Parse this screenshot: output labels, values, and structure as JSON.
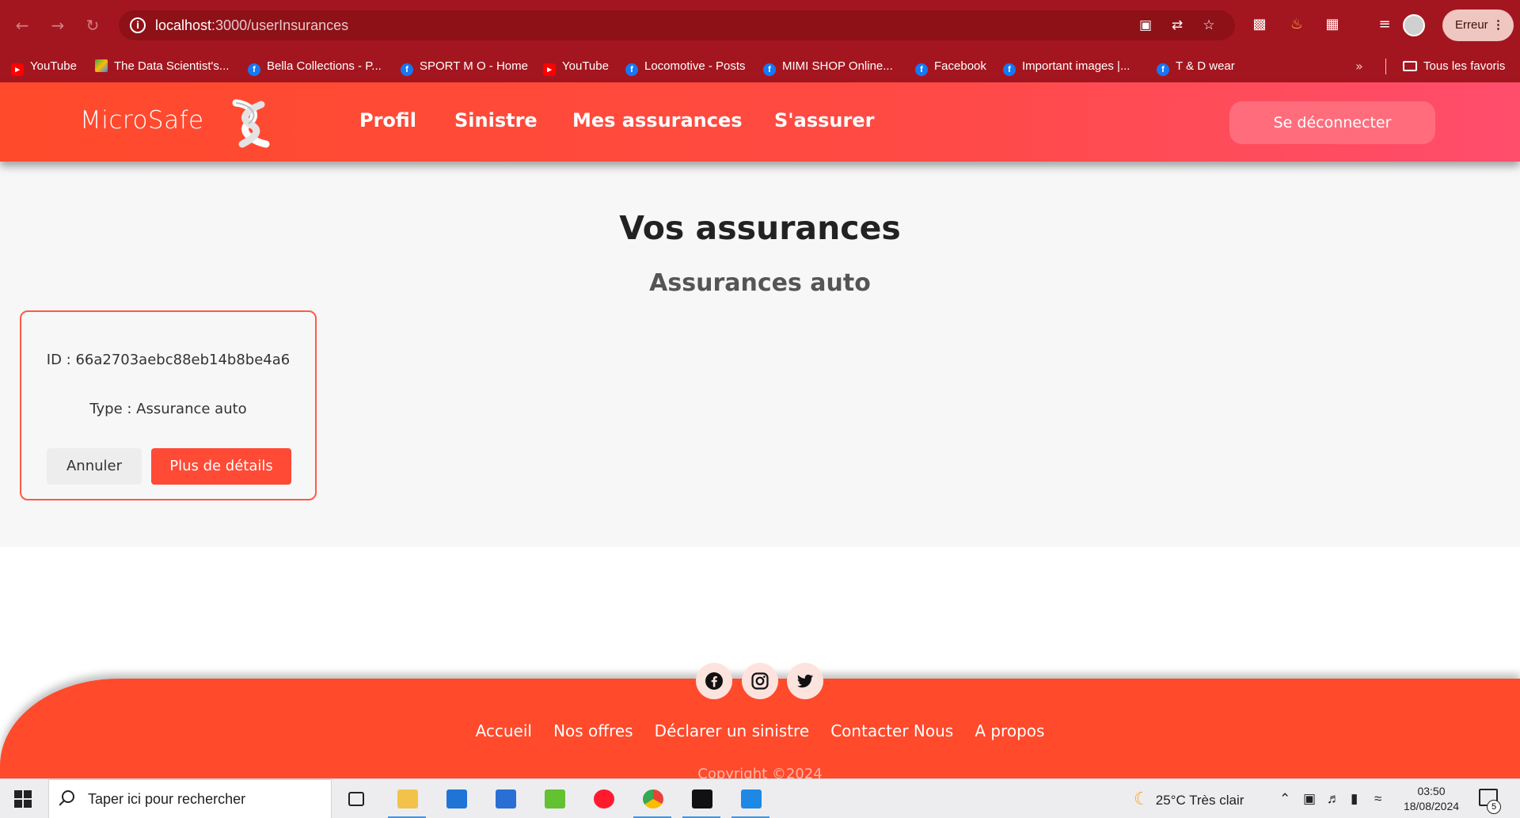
{
  "browser": {
    "url_host": "localhost",
    "url_path": ":3000/userInsurances",
    "profile_label": "Erreur",
    "bookmarks": [
      {
        "label": "YouTube",
        "icon": "youtube-icon"
      },
      {
        "label": "The Data Scientist's...",
        "icon": "google-drive-icon"
      },
      {
        "label": "Bella Collections - P...",
        "icon": "facebook-icon"
      },
      {
        "label": "SPORT M O - Home",
        "icon": "facebook-icon"
      },
      {
        "label": "YouTube",
        "icon": "youtube-icon"
      },
      {
        "label": "Locomotive - Posts",
        "icon": "facebook-icon"
      },
      {
        "label": "MIMI SHOP Online...",
        "icon": "facebook-icon"
      },
      {
        "label": "Facebook",
        "icon": "facebook-icon"
      },
      {
        "label": "Important images |...",
        "icon": "facebook-icon"
      },
      {
        "label": "T & D wear",
        "icon": "facebook-icon"
      }
    ],
    "bookmarks_more": "»",
    "all_bookmarks": "Tous les favoris"
  },
  "header": {
    "brand": "MicroSafe",
    "nav": [
      "Profil",
      "Sinistre",
      "Mes assurances",
      "S'assurer"
    ],
    "logout": "Se déconnecter"
  },
  "main": {
    "title": "Vos assurances",
    "section": "Assurances auto",
    "card": {
      "id_line": "ID : 66a2703aebc88eb14b8be4a6",
      "type_line": "Type : Assurance auto",
      "cancel": "Annuler",
      "details": "Plus de détails"
    }
  },
  "footer": {
    "links": [
      "Accueil",
      "Nos offres",
      "Déclarer un sinistre",
      "Contacter Nous",
      "A propos"
    ],
    "faded": "Copyright ©2024"
  },
  "taskbar": {
    "search_placeholder": "Taper ici pour rechercher",
    "weather": "25°C  Très clair",
    "time": "03:50",
    "date": "18/08/2024",
    "notifications": "5"
  },
  "colors": {
    "browser_frame": "#a4161f",
    "accent": "#ff4a2b",
    "card_border": "#ff5a45",
    "details_button": "#ff4a36"
  }
}
